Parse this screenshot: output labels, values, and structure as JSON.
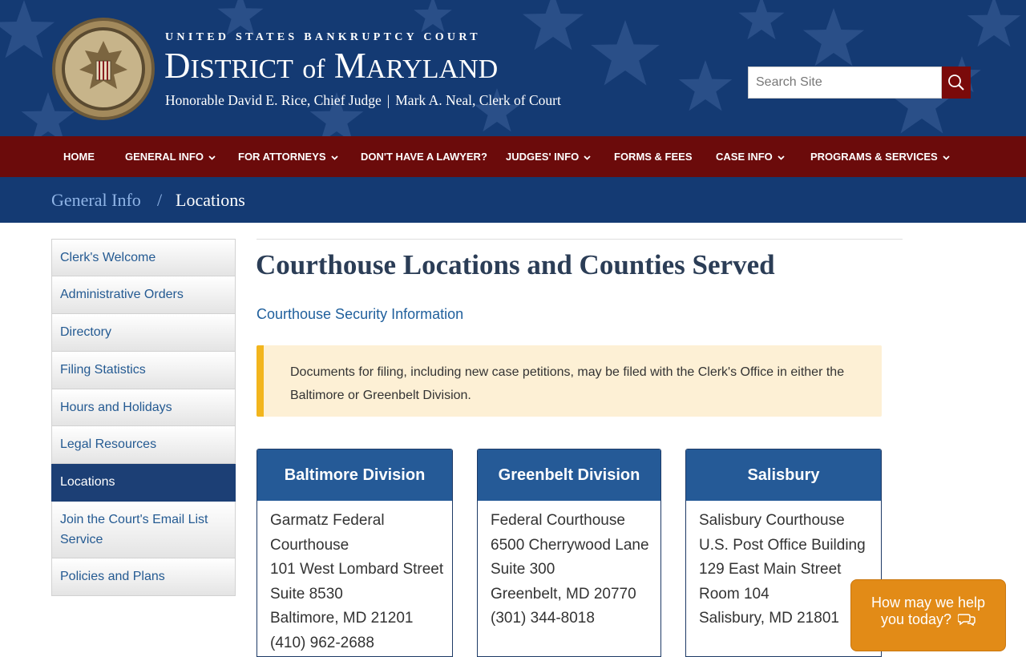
{
  "header": {
    "court_name": "UNITED STATES BANKRUPTCY COURT",
    "district_first": "D",
    "district_rest": "ISTRICT",
    "district_of": "of",
    "md_first": "M",
    "md_rest": "ARYLAND",
    "chief_judge": "Honorable David E. Rice, Chief Judge",
    "separator": "|",
    "clerk": "Mark A. Neal, Clerk of Court",
    "search_placeholder": "Search Site"
  },
  "nav": [
    {
      "label": "HOME",
      "dropdown": false
    },
    {
      "label": "GENERAL INFO",
      "dropdown": true
    },
    {
      "label": "FOR ATTORNEYS",
      "dropdown": true
    },
    {
      "label": "DON'T HAVE A LAWYER?",
      "dropdown": false
    },
    {
      "label": "JUDGES' INFO",
      "dropdown": true
    },
    {
      "label": "FORMS & FEES",
      "dropdown": false
    },
    {
      "label": "CASE INFO",
      "dropdown": true
    },
    {
      "label": "PROGRAMS & SERVICES",
      "dropdown": true
    }
  ],
  "breadcrumb": {
    "parent": "General Info",
    "separator": "/",
    "current": "Locations"
  },
  "sidebar": {
    "items": [
      {
        "label": "Clerk's Welcome",
        "active": false
      },
      {
        "label": "Administrative Orders",
        "active": false
      },
      {
        "label": "Directory",
        "active": false
      },
      {
        "label": "Filing Statistics",
        "active": false
      },
      {
        "label": "Hours and Holidays",
        "active": false
      },
      {
        "label": "Legal Resources",
        "active": false
      },
      {
        "label": "Locations",
        "active": true
      },
      {
        "label": "Join the Court's Email List Service",
        "active": false
      },
      {
        "label": "Policies and Plans",
        "active": false
      }
    ]
  },
  "main": {
    "title": "Courthouse Locations and Counties Served",
    "security_link": "Courthouse Security Information",
    "alert": "Documents for filing, including new case petitions, may be filed with the Clerk's Office in either the Baltimore or Greenbelt Division.",
    "cards": [
      {
        "title": "Baltimore Division",
        "lines": [
          "Garmatz Federal",
          "Courthouse",
          "101 West Lombard Street",
          "Suite 8530",
          "Baltimore, MD 21201",
          "(410) 962-2688"
        ]
      },
      {
        "title": "Greenbelt Division",
        "lines": [
          "Federal Courthouse",
          "6500 Cherrywood Lane",
          "Suite 300",
          "Greenbelt, MD 20770",
          "(301) 344-8018"
        ]
      },
      {
        "title": "Salisbury",
        "lines": [
          "Salisbury Courthouse",
          "U.S. Post Office Building",
          "129 East Main Street",
          "Room 104",
          "Salisbury, MD 21801"
        ]
      }
    ]
  },
  "chat": {
    "line1": "How may we help",
    "line2": "you today?"
  },
  "colors": {
    "header_blue": "#143a73",
    "nav_red": "#6b0b0b",
    "card_blue": "#255a97",
    "link_blue": "#1f5f9c",
    "alert_bg": "#fdf0d5",
    "alert_border": "#f2b51d",
    "chat_orange": "#e28b17"
  }
}
